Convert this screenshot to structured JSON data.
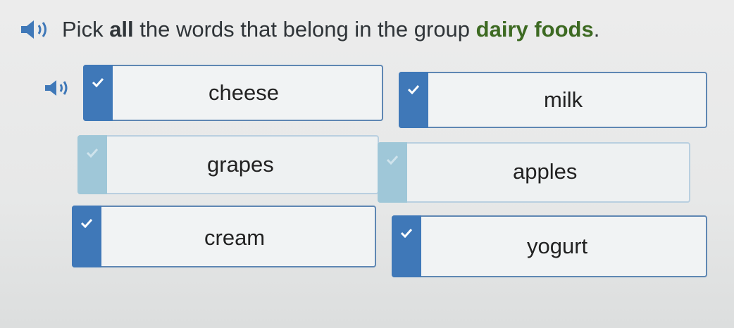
{
  "prompt": {
    "part1": "Pick ",
    "bold": "all",
    "part2": " the words that belong in the group ",
    "group": "dairy foods",
    "end": "."
  },
  "icons": {
    "audio": "speaker-icon",
    "check": "checkmark-icon"
  },
  "colors": {
    "selected_tab": "#3f78b8",
    "unselected_tab": "#9fc7d8",
    "group_text": "#3d6a22"
  },
  "options": [
    {
      "word": "cheese",
      "selected": true
    },
    {
      "word": "milk",
      "selected": true
    },
    {
      "word": "grapes",
      "selected": false
    },
    {
      "word": "apples",
      "selected": false
    },
    {
      "word": "cream",
      "selected": true
    },
    {
      "word": "yogurt",
      "selected": true
    }
  ]
}
